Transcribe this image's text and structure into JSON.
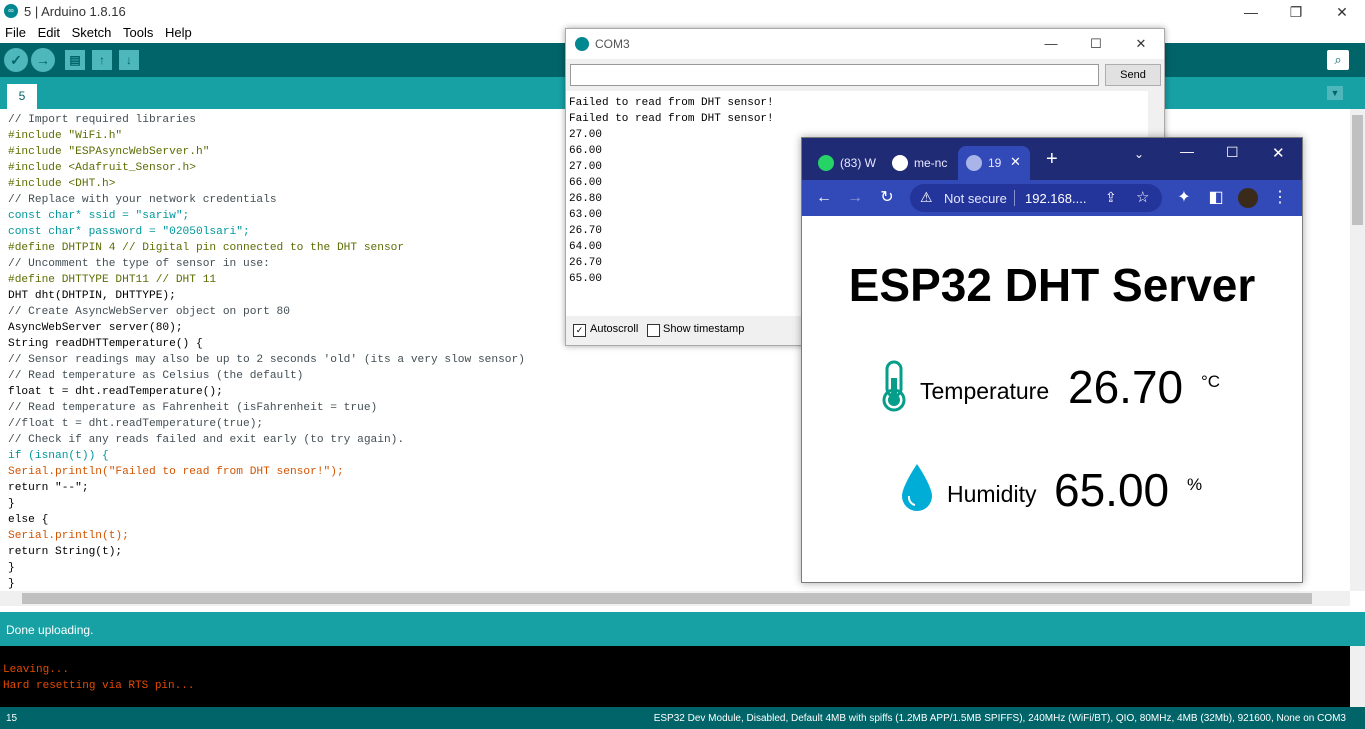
{
  "arduino": {
    "title": "5 | Arduino 1.8.16",
    "menu": [
      "File",
      "Edit",
      "Sketch",
      "Tools",
      "Help"
    ],
    "toolbar_icons": [
      "verify-icon",
      "upload-icon",
      "new-icon",
      "open-icon",
      "save-icon",
      "serial-monitor-icon"
    ],
    "tab_label": "5",
    "code_lines": [
      "// Import required libraries",
      "#include \"WiFi.h\"",
      "#include \"ESPAsyncWebServer.h\"",
      "#include <Adafruit_Sensor.h>",
      "#include <DHT.h>",
      "// Replace with your network credentials",
      "const char* ssid = \"sariw\";",
      "const char* password = \"02050lsari\";",
      "#define DHTPIN 4 // Digital pin connected to the DHT sensor",
      "// Uncomment the type of sensor in use:",
      "#define DHTTYPE DHT11 // DHT 11",
      "DHT dht(DHTPIN, DHTTYPE);",
      "// Create AsyncWebServer object on port 80",
      "AsyncWebServer server(80);",
      "String readDHTTemperature() {",
      "// Sensor readings may also be up to 2 seconds 'old' (its a very slow sensor)",
      "// Read temperature as Celsius (the default)",
      "float t = dht.readTemperature();",
      "// Read temperature as Fahrenheit (isFahrenheit = true)",
      "//float t = dht.readTemperature(true);",
      "// Check if any reads failed and exit early (to try again).",
      "if (isnan(t)) {",
      "Serial.println(\"Failed to read from DHT sensor!\");",
      "return \"--\";",
      "}",
      "else {",
      "Serial.println(t);",
      "return String(t);",
      "}",
      "}"
    ],
    "status_text": "Done uploading.",
    "console_lines": [
      "Leaving...",
      "Hard resetting via RTS pin..."
    ],
    "line_number": "15",
    "board_info": "ESP32 Dev Module, Disabled, Default 4MB with spiffs (1.2MB APP/1.5MB SPIFFS), 240MHz (WiFi/BT), QIO, 80MHz, 4MB (32Mb), 921600, None on COM3",
    "colors": {
      "teal_dark": "#006468",
      "teal": "#17a1a5",
      "console_text": "#e34c00"
    }
  },
  "serial_monitor": {
    "title": "COM3",
    "input_value": "",
    "send_label": "Send",
    "output_lines": [
      "Failed to read from DHT sensor!",
      "Failed to read from DHT sensor!",
      "27.00",
      "66.00",
      "27.00",
      "66.00",
      "26.80",
      "63.00",
      "26.70",
      "64.00",
      "26.70",
      "65.00"
    ],
    "autoscroll_label": "Autoscroll",
    "autoscroll_checked": true,
    "timestamp_label": "Show timestamp",
    "timestamp_checked": false
  },
  "browser": {
    "tabs": [
      {
        "label": "(83) W",
        "icon": "whatsapp-icon"
      },
      {
        "label": "me-nc",
        "icon": "github-icon"
      },
      {
        "label": "19",
        "icon": "globe-icon",
        "active": true
      }
    ],
    "not_secure_label": "Not secure",
    "url": "192.168....",
    "page": {
      "heading": "ESP32 DHT Server",
      "temperature_label": "Temperature",
      "temperature_value": "26.70",
      "temperature_unit": "°C",
      "humidity_label": "Humidity",
      "humidity_value": "65.00",
      "humidity_unit": "%"
    },
    "colors": {
      "tab_bar": "#202b75",
      "nav_bar": "#3249b8",
      "thermometer": "#059e8a",
      "droplet": "#00add6"
    }
  }
}
